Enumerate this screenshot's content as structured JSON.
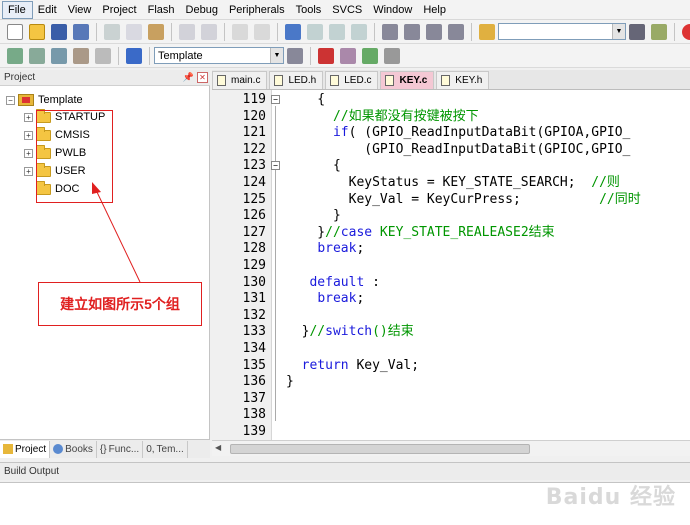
{
  "menu": [
    "File",
    "Edit",
    "View",
    "Project",
    "Flash",
    "Debug",
    "Peripherals",
    "Tools",
    "SVCS",
    "Window",
    "Help"
  ],
  "toolbar2": {
    "target": "Template"
  },
  "project_panel": {
    "title": "Project",
    "root": "Template",
    "groups": [
      "STARTUP",
      "CMSIS",
      "PWLB",
      "USER",
      "DOC"
    ],
    "annotation": "建立如图所示5个组",
    "tabs": [
      "Project",
      "Books",
      "Func...",
      "Tem..."
    ]
  },
  "editor": {
    "tabs": [
      "main.c",
      "LED.h",
      "LED.c",
      "KEY.c",
      "KEY.h"
    ],
    "active_tab": "KEY.c",
    "lines": [
      {
        "n": "119",
        "code": "    {"
      },
      {
        "n": "120",
        "code": "      //如果都没有按键被按下"
      },
      {
        "n": "121",
        "code": "      if( (GPIO_ReadInputDataBit(GPIOA,GPIO_"
      },
      {
        "n": "122",
        "code": "          (GPIO_ReadInputDataBit(GPIOC,GPIO_"
      },
      {
        "n": "123",
        "code": "      {"
      },
      {
        "n": "124",
        "code": "        KeyStatus = KEY_STATE_SEARCH;  //则"
      },
      {
        "n": "125",
        "code": "        Key_Val = KeyCurPress;          //同时"
      },
      {
        "n": "126",
        "code": "      }"
      },
      {
        "n": "127",
        "code": "    }//case KEY_STATE_REALEASE2结束"
      },
      {
        "n": "128",
        "code": "    break;"
      },
      {
        "n": "129",
        "code": ""
      },
      {
        "n": "130",
        "code": "   default :"
      },
      {
        "n": "131",
        "code": "    break;"
      },
      {
        "n": "132",
        "code": ""
      },
      {
        "n": "133",
        "code": "  }//switch()结束"
      },
      {
        "n": "134",
        "code": ""
      },
      {
        "n": "135",
        "code": "  return Key_Val;"
      },
      {
        "n": "136",
        "code": "}"
      },
      {
        "n": "137",
        "code": ""
      },
      {
        "n": "138",
        "code": ""
      },
      {
        "n": "139",
        "code": ""
      }
    ]
  },
  "build_output": {
    "title": "Build Output"
  },
  "watermark": "Baidu 经验"
}
